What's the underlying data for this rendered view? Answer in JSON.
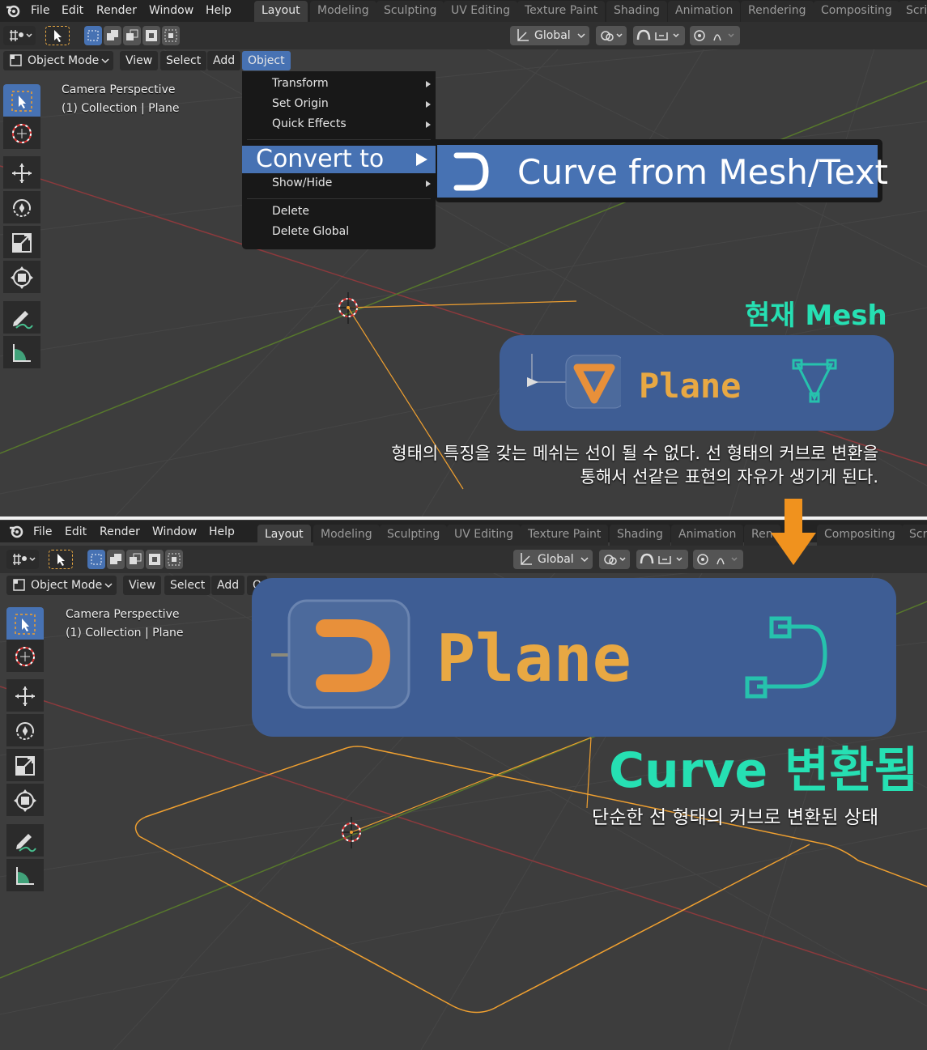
{
  "colors": {
    "ui_bg": "#303030",
    "topbar_bg": "#232323",
    "viewport_bg": "#3d3d3d",
    "accent_blue": "#4772b3",
    "callout_blue": "#3e5d94",
    "teal": "#26e0b3",
    "orange": "#f0a030",
    "plane_orange": "#e8a843",
    "axis_x": "#c8474b",
    "axis_y": "#6e9a32"
  },
  "top": {
    "menu": [
      "File",
      "Edit",
      "Render",
      "Window",
      "Help"
    ],
    "tabs": [
      "Layout",
      "Modeling",
      "Sculpting",
      "UV Editing",
      "Texture Paint",
      "Shading",
      "Animation",
      "Rendering",
      "Compositing",
      "Scri"
    ],
    "transform_orientation": "Global",
    "mode": "Object Mode",
    "view_menu": [
      "View",
      "Select",
      "Add",
      "Object"
    ],
    "overlay_title": "Camera Perspective",
    "overlay_collection": "(1) Collection | Plane",
    "object_menu": {
      "items_top": [
        "Transform",
        "Set Origin",
        "Quick Effects"
      ],
      "convert_to": "Convert to",
      "show_hide": "Show/Hide",
      "items_bottom": [
        "Delete",
        "Delete Global"
      ]
    },
    "submenu_item": "Curve from Mesh/Text",
    "callout_title": "현재 Mesh",
    "outliner_name": "Plane",
    "caption_line1": "형태의 특징을 갖는 메쉬는 선이 될 수 없다. 선 형태의 커브로 변환을",
    "caption_line2": "통해서  선같은 표현의 자유가 생기게 된다."
  },
  "bottom": {
    "menu": [
      "File",
      "Edit",
      "Render",
      "Window",
      "Help"
    ],
    "tabs": [
      "Layout",
      "Modeling",
      "Sculpting",
      "UV Editing",
      "Texture Paint",
      "Shading",
      "Animation",
      "Ren",
      "Compositing",
      "Scri"
    ],
    "transform_orientation": "Global",
    "mode": "Object Mode",
    "view_menu": [
      "View",
      "Select",
      "Add",
      "O"
    ],
    "overlay_title": "Camera Perspective",
    "overlay_collection": "(1) Collection | Plane",
    "outliner_name": "Plane",
    "callout_title": "Curve 변환됨",
    "caption": "단순한 선 형태의 커브로 변환된 상태"
  },
  "icons": [
    "blender-logo-icon",
    "select-box-icon",
    "cursor-icon",
    "move-icon",
    "rotate-icon",
    "scale-icon",
    "transform-icon",
    "annotate-icon",
    "measure-icon",
    "mesh-triangle-icon",
    "curve-icon",
    "vertex-icon",
    "arrow-down-icon"
  ]
}
